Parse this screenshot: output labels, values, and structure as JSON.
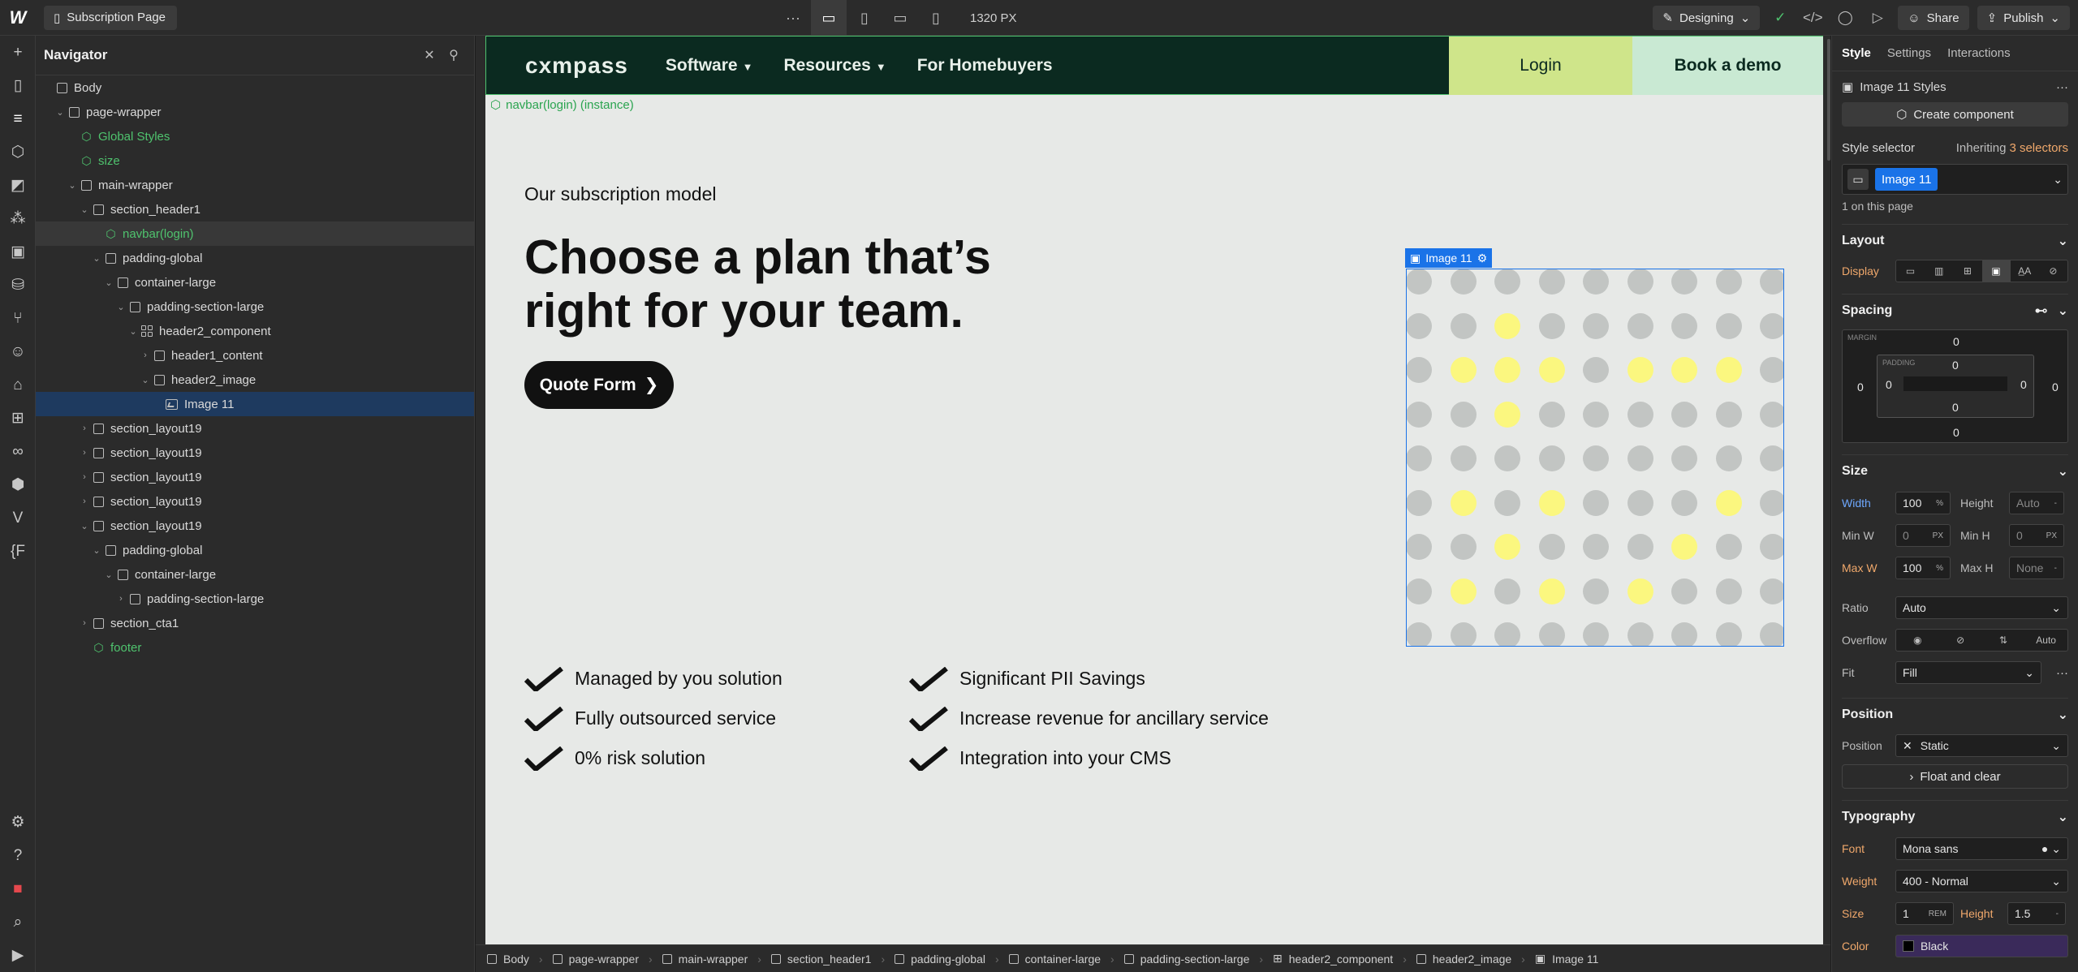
{
  "topbar": {
    "logo": "W",
    "page_name": "Subscription Page",
    "more": "···",
    "width_readout": "1320 PX",
    "mode": "Designing",
    "share": "Share",
    "publish": "Publish"
  },
  "navigator": {
    "title": "Navigator",
    "items": [
      {
        "label": "Body",
        "indent": 0,
        "kind": "box",
        "caret": ""
      },
      {
        "label": "page-wrapper",
        "indent": 1,
        "kind": "box",
        "caret": "v"
      },
      {
        "label": "Global Styles",
        "indent": 2,
        "kind": "component",
        "caret": ""
      },
      {
        "label": "size",
        "indent": 2,
        "kind": "component",
        "caret": ""
      },
      {
        "label": "main-wrapper",
        "indent": 2,
        "kind": "box",
        "caret": "v"
      },
      {
        "label": "section_header1",
        "indent": 3,
        "kind": "box",
        "caret": "v"
      },
      {
        "label": "navbar(login)",
        "indent": 4,
        "kind": "component",
        "caret": "",
        "state": "hover"
      },
      {
        "label": "padding-global",
        "indent": 4,
        "kind": "box",
        "caret": "v"
      },
      {
        "label": "container-large",
        "indent": 5,
        "kind": "box",
        "caret": "v"
      },
      {
        "label": "padding-section-large",
        "indent": 6,
        "kind": "box",
        "caret": "v"
      },
      {
        "label": "header2_component",
        "indent": 7,
        "kind": "grid",
        "caret": "v"
      },
      {
        "label": "header1_content",
        "indent": 8,
        "kind": "box",
        "caret": ">"
      },
      {
        "label": "header2_image",
        "indent": 8,
        "kind": "box",
        "caret": "v"
      },
      {
        "label": "Image 11",
        "indent": 9,
        "kind": "image",
        "caret": "",
        "state": "selected"
      },
      {
        "label": "section_layout19",
        "indent": 3,
        "kind": "box",
        "caret": ">"
      },
      {
        "label": "section_layout19",
        "indent": 3,
        "kind": "box",
        "caret": ">"
      },
      {
        "label": "section_layout19",
        "indent": 3,
        "kind": "box",
        "caret": ">"
      },
      {
        "label": "section_layout19",
        "indent": 3,
        "kind": "box",
        "caret": ">"
      },
      {
        "label": "section_layout19",
        "indent": 3,
        "kind": "box",
        "caret": "v"
      },
      {
        "label": "padding-global",
        "indent": 4,
        "kind": "box",
        "caret": "v"
      },
      {
        "label": "container-large",
        "indent": 5,
        "kind": "box",
        "caret": "v"
      },
      {
        "label": "padding-section-large",
        "indent": 6,
        "kind": "box",
        "caret": ">"
      },
      {
        "label": "section_cta1",
        "indent": 3,
        "kind": "box",
        "caret": ">"
      },
      {
        "label": "footer",
        "indent": 3,
        "kind": "component",
        "caret": ""
      }
    ]
  },
  "site": {
    "brand": "cxmpass",
    "nav": [
      "Software",
      "Resources",
      "For Homebuyers"
    ],
    "nav_dropdown": [
      true,
      true,
      false
    ],
    "login": "Login",
    "demo": "Book a demo",
    "instance_tag": "navbar(login) (instance)",
    "eyebrow": "Our subscription model",
    "headline": "Choose a plan that’s right for your team.",
    "cta": "Quote Form",
    "checks_left": [
      "Managed by you solution",
      "Fully outsourced service",
      "0% risk solution"
    ],
    "checks_right": [
      "Significant PII Savings",
      "Increase revenue for ancillary service",
      "Integration into your CMS"
    ],
    "image_label": "Image 11",
    "dot_grid": {
      "rows": 9,
      "cols": 9,
      "gray": "#c2c5c3",
      "yellow": "#fbf77f",
      "highlighted": [
        [
          1,
          2
        ],
        [
          2,
          1
        ],
        [
          2,
          2
        ],
        [
          2,
          3
        ],
        [
          2,
          5
        ],
        [
          2,
          6
        ],
        [
          2,
          7
        ],
        [
          3,
          2
        ],
        [
          5,
          1
        ],
        [
          5,
          3
        ],
        [
          5,
          7
        ],
        [
          6,
          2
        ],
        [
          6,
          6
        ],
        [
          7,
          1
        ],
        [
          7,
          3
        ],
        [
          7,
          5
        ]
      ]
    }
  },
  "breadcrumbs": [
    "Body",
    "page-wrapper",
    "main-wrapper",
    "section_header1",
    "padding-global",
    "container-large",
    "padding-section-large",
    "header2_component",
    "header2_image",
    "Image 11"
  ],
  "panel": {
    "tabs": [
      "Style",
      "Settings",
      "Interactions"
    ],
    "styles_title": "Image 11 Styles",
    "create_component": "Create component",
    "style_selector": "Style selector",
    "inheriting": "Inheriting",
    "inheriting_count": "3 selectors",
    "selector_chip": "Image 11",
    "on_page": "1 on this page",
    "layout": "Layout",
    "display": "Display",
    "spacing": "Spacing",
    "margin_label": "MARGIN",
    "padding_label": "PADDING",
    "zero": "0",
    "size": "Size",
    "width": "Width",
    "width_val": "100",
    "pct": "%",
    "height": "Height",
    "height_val": "Auto",
    "minw": "Min W",
    "minw_val": "0",
    "px": "PX",
    "minh": "Min H",
    "minh_val": "0",
    "maxw": "Max W",
    "maxw_val": "100",
    "maxh": "Max H",
    "maxh_val": "None",
    "ratio": "Ratio",
    "ratio_val": "Auto",
    "overflow": "Overflow",
    "overflow_auto": "Auto",
    "fit": "Fit",
    "fit_val": "Fill",
    "position": "Position",
    "position_val": "Static",
    "float_clear": "Float and clear",
    "typography": "Typography",
    "font": "Font",
    "font_val": "Mona sans",
    "weight": "Weight",
    "weight_val": "400 - Normal",
    "tsize": "Size",
    "tsize_val": "1",
    "rem": "REM",
    "theight": "Height",
    "theight_val": "1.5",
    "color": "Color",
    "color_val": "Black"
  }
}
